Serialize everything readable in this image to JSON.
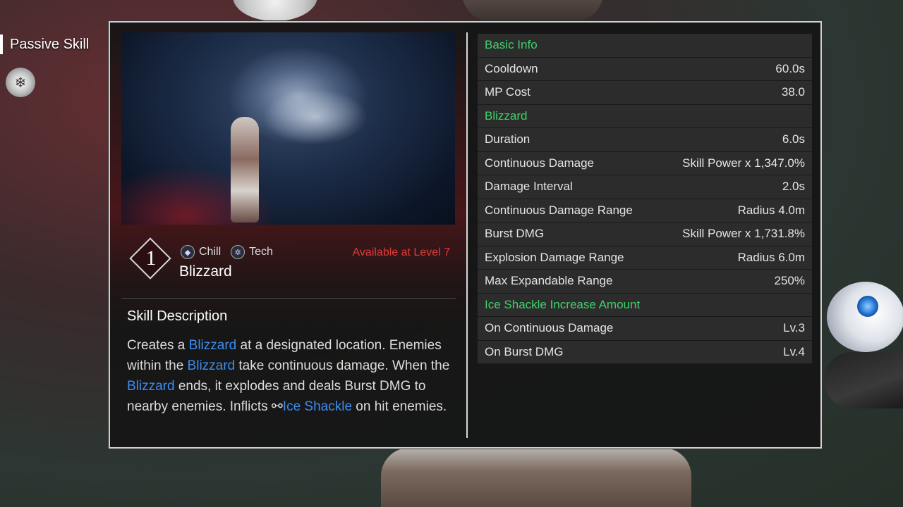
{
  "side_tab": {
    "label": "Passive Skill",
    "icon": "snowflake-skill-icon"
  },
  "skill": {
    "number": "1",
    "name": "Blizzard",
    "tags": [
      {
        "label": "Chill",
        "icon": "chill-icon"
      },
      {
        "label": "Tech",
        "icon": "tech-icon"
      }
    ],
    "availability": "Available at Level 7"
  },
  "description": {
    "title": "Skill Description",
    "parts": {
      "p1": "Creates a ",
      "h1": "Blizzard",
      "p2": " at a designated location. Enemies within the ",
      "h2": "Blizzard",
      "p3": " take continuous damage. When the ",
      "h3": "Blizzard",
      "p4": " ends, it explodes and deals Burst DMG to nearby enemies. Inflicts ",
      "h4": "Ice Shackle",
      "p5": " on hit enemies."
    }
  },
  "stats": {
    "section_basic": "Basic Info",
    "cooldown_label": "Cooldown",
    "cooldown_value": "60.0s",
    "mp_label": "MP Cost",
    "mp_value": "38.0",
    "section_blizzard": "Blizzard",
    "duration_label": "Duration",
    "duration_value": "6.0s",
    "cont_dmg_label": "Continuous Damage",
    "cont_dmg_value": "Skill Power x 1,347.0%",
    "interval_label": "Damage Interval",
    "interval_value": "2.0s",
    "cont_range_label": "Continuous Damage Range",
    "cont_range_value": "Radius 4.0m",
    "burst_label": "Burst DMG",
    "burst_value": "Skill Power x 1,731.8%",
    "expl_range_label": "Explosion Damage Range",
    "expl_range_value": "Radius 6.0m",
    "max_exp_label": "Max Expandable Range",
    "max_exp_value": "250%",
    "section_ice": "Ice Shackle Increase Amount",
    "on_cont_label": "On Continuous Damage",
    "on_cont_value": "Lv.3",
    "on_burst_label": "On Burst DMG",
    "on_burst_value": "Lv.4"
  },
  "colors": {
    "section": "#3fd26a",
    "highlight": "#3d8cf0",
    "warning": "#e03a3a"
  }
}
